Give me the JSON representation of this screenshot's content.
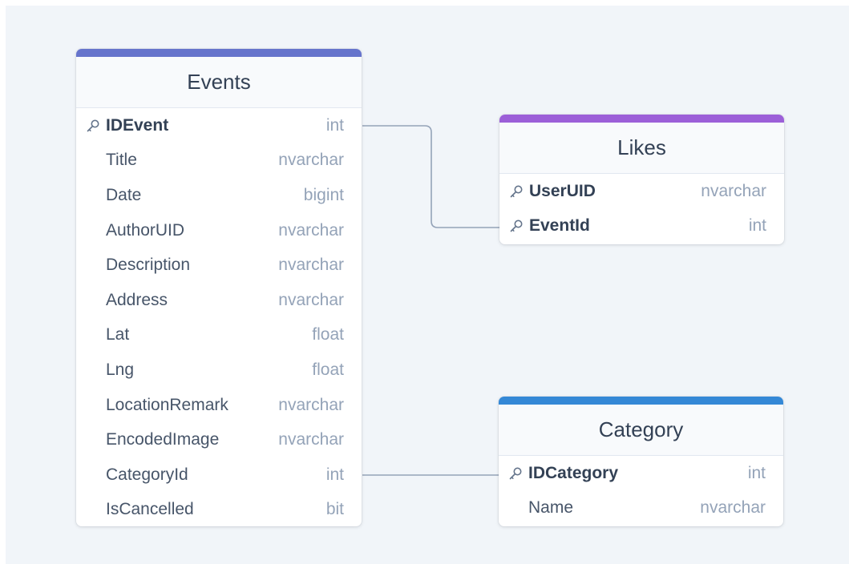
{
  "colors": {
    "events_accent": "#6674cc",
    "likes_accent": "#9c5fd8",
    "category_accent": "#3488d6",
    "edge": "#94a3b8"
  },
  "tables": {
    "events": {
      "title": "Events",
      "columns": [
        {
          "name": "IDEvent",
          "type": "int",
          "key": true
        },
        {
          "name": "Title",
          "type": "nvarchar",
          "key": false
        },
        {
          "name": "Date",
          "type": "bigint",
          "key": false
        },
        {
          "name": "AuthorUID",
          "type": "nvarchar",
          "key": false
        },
        {
          "name": "Description",
          "type": "nvarchar",
          "key": false
        },
        {
          "name": "Address",
          "type": "nvarchar",
          "key": false
        },
        {
          "name": "Lat",
          "type": "float",
          "key": false
        },
        {
          "name": "Lng",
          "type": "float",
          "key": false
        },
        {
          "name": "LocationRemark",
          "type": "nvarchar",
          "key": false
        },
        {
          "name": "EncodedImage",
          "type": "nvarchar",
          "key": false
        },
        {
          "name": "CategoryId",
          "type": "int",
          "key": false
        },
        {
          "name": "IsCancelled",
          "type": "bit",
          "key": false
        }
      ]
    },
    "likes": {
      "title": "Likes",
      "columns": [
        {
          "name": "UserUID",
          "type": "nvarchar",
          "key": true
        },
        {
          "name": "EventId",
          "type": "int",
          "key": true
        }
      ]
    },
    "category": {
      "title": "Category",
      "columns": [
        {
          "name": "IDCategory",
          "type": "int",
          "key": true
        },
        {
          "name": "Name",
          "type": "nvarchar",
          "key": false
        }
      ]
    }
  },
  "relations": [
    {
      "from": "Events.IDEvent",
      "to": "Likes.EventId"
    },
    {
      "from": "Events.CategoryId",
      "to": "Category.IDCategory"
    }
  ]
}
